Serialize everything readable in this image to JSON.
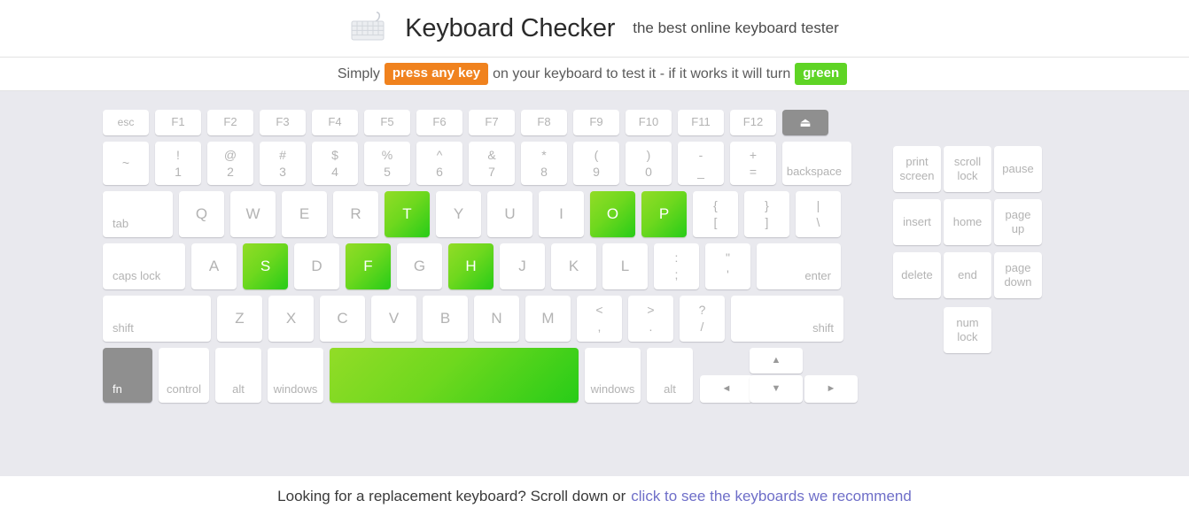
{
  "header": {
    "icon": "keyboard-icon",
    "title": "Keyboard Checker",
    "tagline": "the best online keyboard tester"
  },
  "banner": {
    "prefix": "Simply",
    "badge_orange": "press any key",
    "middle": "on your keyboard to test it - if it works it will turn",
    "badge_green": "green",
    "colors": {
      "orange": "#f0821e",
      "green": "#5fd425"
    }
  },
  "keyboard": {
    "pressed_color_from": "#92dc27",
    "pressed_color_to": "#27cc18",
    "key_color": "#ffffff",
    "disabled_color": "#8f8f8f",
    "background": "#e9e9ee",
    "function_row": {
      "esc": "esc",
      "f1": "F1",
      "f2": "F2",
      "f3": "F3",
      "f4": "F4",
      "f5": "F5",
      "f6": "F6",
      "f7": "F7",
      "f8": "F8",
      "f9": "F9",
      "f10": "F10",
      "f11": "F11",
      "f12": "F12",
      "eject": "⏏"
    },
    "number_row": {
      "tilde_top": "~",
      "tilde_bot": "",
      "k1_top": "!",
      "k1_bot": "1",
      "k2_top": "@",
      "k2_bot": "2",
      "k3_top": "#",
      "k3_bot": "3",
      "k4_top": "$",
      "k4_bot": "4",
      "k5_top": "%",
      "k5_bot": "5",
      "k6_top": "^",
      "k6_bot": "6",
      "k7_top": "&",
      "k7_bot": "7",
      "k8_top": "*",
      "k8_bot": "8",
      "k9_top": "(",
      "k9_bot": "9",
      "k0_top": ")",
      "k0_bot": "0",
      "minus_top": "-",
      "minus_bot": "_",
      "equal_top": "+",
      "equal_bot": "=",
      "backspace": "backspace"
    },
    "qwerty_row": {
      "tab": "tab",
      "q": "Q",
      "w": "W",
      "e": "E",
      "r": "R",
      "t": "T",
      "y": "Y",
      "u": "U",
      "i": "I",
      "o": "O",
      "p": "P",
      "lbracket_top": "{",
      "lbracket_bot": "[",
      "rbracket_top": "}",
      "rbracket_bot": "]",
      "backslash_top": "|",
      "backslash_bot": "\\"
    },
    "home_row": {
      "caps_lock": "caps lock",
      "a": "A",
      "s": "S",
      "d": "D",
      "f": "F",
      "g": "G",
      "h": "H",
      "j": "J",
      "k": "K",
      "l": "L",
      "semicolon_top": ":",
      "semicolon_bot": ";",
      "quote_top": "\"",
      "quote_bot": "'",
      "enter": "enter"
    },
    "shift_row": {
      "lshift": "shift",
      "z": "Z",
      "x": "X",
      "c": "C",
      "v": "V",
      "b": "B",
      "n": "N",
      "m": "M",
      "comma_top": "<",
      "comma_bot": ",",
      "period_top": ">",
      "period_bot": ".",
      "slash_top": "?",
      "slash_bot": "/",
      "rshift": "shift"
    },
    "bottom_row": {
      "fn": "fn",
      "control": "control",
      "lalt": "alt",
      "lwindows": "windows",
      "space": "",
      "rwindows": "windows",
      "ralt": "alt"
    },
    "arrows": {
      "up": "▲",
      "left": "◄",
      "down": "▼",
      "right": "►"
    },
    "nav_cluster": {
      "print_screen_l1": "print",
      "print_screen_l2": "screen",
      "scroll_lock_l1": "scroll",
      "scroll_lock_l2": "lock",
      "pause": "pause",
      "insert": "insert",
      "home": "home",
      "page_up_l1": "page",
      "page_up_l2": "up",
      "delete": "delete",
      "end": "end",
      "page_down_l1": "page",
      "page_down_l2": "down",
      "num_lock_l1": "num",
      "num_lock_l2": "lock"
    },
    "pressed_keys": [
      "T",
      "O",
      "P",
      "S",
      "F",
      "H",
      "space"
    ]
  },
  "footer": {
    "text": "Looking for a replacement keyboard? Scroll down or",
    "link": "click to see the keyboards we recommend",
    "link_color": "#6e6ec8"
  }
}
